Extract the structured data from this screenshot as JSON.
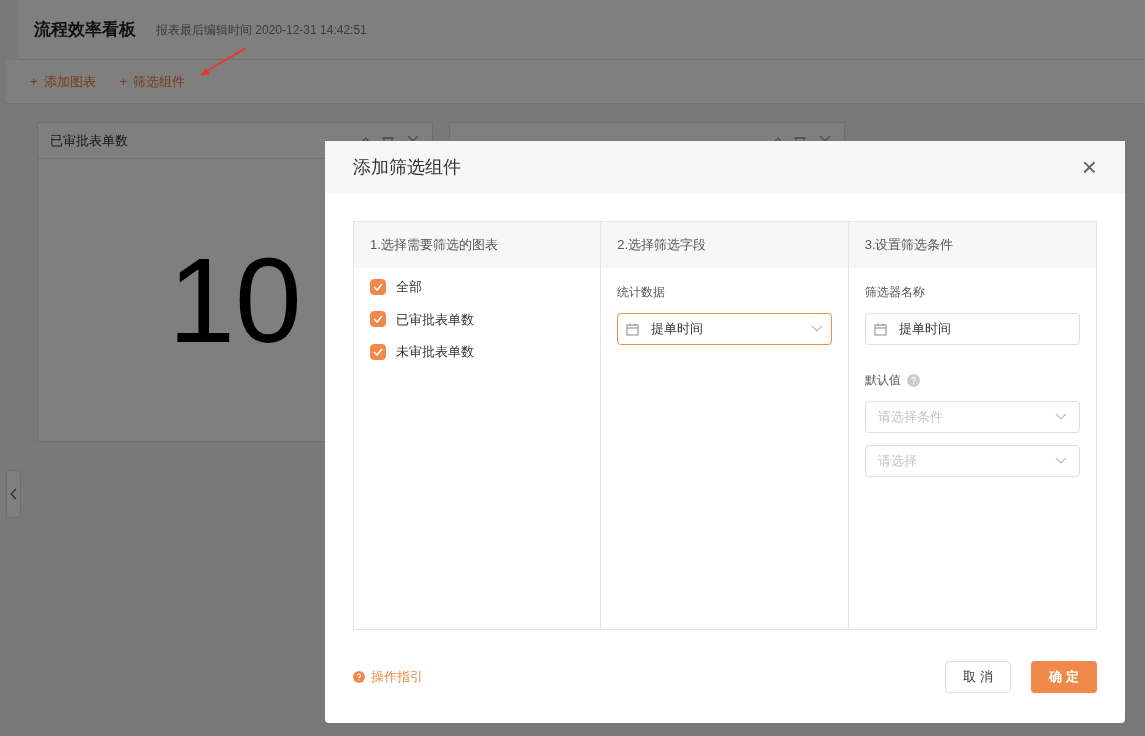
{
  "page": {
    "title": "流程效率看板",
    "subtitle": "报表最后编辑时间 2020-12-31 14:42:51"
  },
  "toolbar": [
    {
      "icon": "+",
      "label": "添加图表"
    },
    {
      "icon": "+",
      "label": "筛选组件"
    }
  ],
  "cards": [
    {
      "kind": "metric",
      "title": "已审批表单数",
      "value": "10"
    },
    {
      "kind": "metric"
    }
  ],
  "dialog": {
    "title": "添加筛选组件",
    "close": "×",
    "columns": [
      {
        "header": "1.选择需要筛选的图表"
      },
      {
        "header": "2.选择筛选字段"
      },
      {
        "header": "3.设置筛选条件"
      }
    ],
    "charts": [
      {
        "label": "全部",
        "checked": true
      },
      {
        "label": "已审批表单数",
        "checked": true
      },
      {
        "label": "未审批表单数",
        "checked": true
      }
    ],
    "field_group": "统计数据",
    "field": {
      "value": "提单时间",
      "focused": true
    },
    "name_label": "筛选器名称",
    "name_value": "提单时间",
    "default_label": "默认值",
    "condition": {
      "placeholder": "请选择条件"
    },
    "value_select": {
      "placeholder": "请选择"
    },
    "guide_link": "操作指引",
    "buttons": [
      {
        "label": "取 消",
        "kind": "secondary"
      },
      {
        "label": "确 定",
        "kind": "primary"
      }
    ]
  }
}
